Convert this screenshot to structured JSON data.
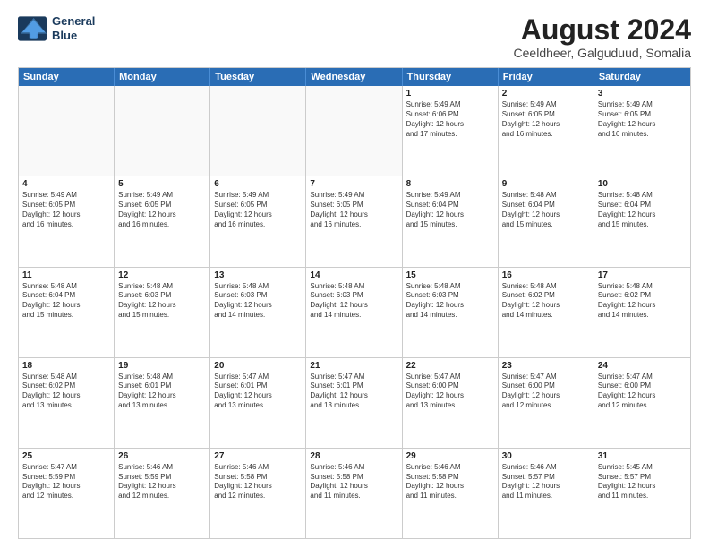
{
  "logo": {
    "line1": "General",
    "line2": "Blue"
  },
  "title": "August 2024",
  "subtitle": "Ceeldheer, Galguduud, Somalia",
  "header": {
    "days": [
      "Sunday",
      "Monday",
      "Tuesday",
      "Wednesday",
      "Thursday",
      "Friday",
      "Saturday"
    ]
  },
  "weeks": [
    [
      {
        "day": "",
        "info": ""
      },
      {
        "day": "",
        "info": ""
      },
      {
        "day": "",
        "info": ""
      },
      {
        "day": "",
        "info": ""
      },
      {
        "day": "1",
        "info": "Sunrise: 5:49 AM\nSunset: 6:06 PM\nDaylight: 12 hours\nand 17 minutes."
      },
      {
        "day": "2",
        "info": "Sunrise: 5:49 AM\nSunset: 6:05 PM\nDaylight: 12 hours\nand 16 minutes."
      },
      {
        "day": "3",
        "info": "Sunrise: 5:49 AM\nSunset: 6:05 PM\nDaylight: 12 hours\nand 16 minutes."
      }
    ],
    [
      {
        "day": "4",
        "info": "Sunrise: 5:49 AM\nSunset: 6:05 PM\nDaylight: 12 hours\nand 16 minutes."
      },
      {
        "day": "5",
        "info": "Sunrise: 5:49 AM\nSunset: 6:05 PM\nDaylight: 12 hours\nand 16 minutes."
      },
      {
        "day": "6",
        "info": "Sunrise: 5:49 AM\nSunset: 6:05 PM\nDaylight: 12 hours\nand 16 minutes."
      },
      {
        "day": "7",
        "info": "Sunrise: 5:49 AM\nSunset: 6:05 PM\nDaylight: 12 hours\nand 16 minutes."
      },
      {
        "day": "8",
        "info": "Sunrise: 5:49 AM\nSunset: 6:04 PM\nDaylight: 12 hours\nand 15 minutes."
      },
      {
        "day": "9",
        "info": "Sunrise: 5:48 AM\nSunset: 6:04 PM\nDaylight: 12 hours\nand 15 minutes."
      },
      {
        "day": "10",
        "info": "Sunrise: 5:48 AM\nSunset: 6:04 PM\nDaylight: 12 hours\nand 15 minutes."
      }
    ],
    [
      {
        "day": "11",
        "info": "Sunrise: 5:48 AM\nSunset: 6:04 PM\nDaylight: 12 hours\nand 15 minutes."
      },
      {
        "day": "12",
        "info": "Sunrise: 5:48 AM\nSunset: 6:03 PM\nDaylight: 12 hours\nand 15 minutes."
      },
      {
        "day": "13",
        "info": "Sunrise: 5:48 AM\nSunset: 6:03 PM\nDaylight: 12 hours\nand 14 minutes."
      },
      {
        "day": "14",
        "info": "Sunrise: 5:48 AM\nSunset: 6:03 PM\nDaylight: 12 hours\nand 14 minutes."
      },
      {
        "day": "15",
        "info": "Sunrise: 5:48 AM\nSunset: 6:03 PM\nDaylight: 12 hours\nand 14 minutes."
      },
      {
        "day": "16",
        "info": "Sunrise: 5:48 AM\nSunset: 6:02 PM\nDaylight: 12 hours\nand 14 minutes."
      },
      {
        "day": "17",
        "info": "Sunrise: 5:48 AM\nSunset: 6:02 PM\nDaylight: 12 hours\nand 14 minutes."
      }
    ],
    [
      {
        "day": "18",
        "info": "Sunrise: 5:48 AM\nSunset: 6:02 PM\nDaylight: 12 hours\nand 13 minutes."
      },
      {
        "day": "19",
        "info": "Sunrise: 5:48 AM\nSunset: 6:01 PM\nDaylight: 12 hours\nand 13 minutes."
      },
      {
        "day": "20",
        "info": "Sunrise: 5:47 AM\nSunset: 6:01 PM\nDaylight: 12 hours\nand 13 minutes."
      },
      {
        "day": "21",
        "info": "Sunrise: 5:47 AM\nSunset: 6:01 PM\nDaylight: 12 hours\nand 13 minutes."
      },
      {
        "day": "22",
        "info": "Sunrise: 5:47 AM\nSunset: 6:00 PM\nDaylight: 12 hours\nand 13 minutes."
      },
      {
        "day": "23",
        "info": "Sunrise: 5:47 AM\nSunset: 6:00 PM\nDaylight: 12 hours\nand 12 minutes."
      },
      {
        "day": "24",
        "info": "Sunrise: 5:47 AM\nSunset: 6:00 PM\nDaylight: 12 hours\nand 12 minutes."
      }
    ],
    [
      {
        "day": "25",
        "info": "Sunrise: 5:47 AM\nSunset: 5:59 PM\nDaylight: 12 hours\nand 12 minutes."
      },
      {
        "day": "26",
        "info": "Sunrise: 5:46 AM\nSunset: 5:59 PM\nDaylight: 12 hours\nand 12 minutes."
      },
      {
        "day": "27",
        "info": "Sunrise: 5:46 AM\nSunset: 5:58 PM\nDaylight: 12 hours\nand 12 minutes."
      },
      {
        "day": "28",
        "info": "Sunrise: 5:46 AM\nSunset: 5:58 PM\nDaylight: 12 hours\nand 11 minutes."
      },
      {
        "day": "29",
        "info": "Sunrise: 5:46 AM\nSunset: 5:58 PM\nDaylight: 12 hours\nand 11 minutes."
      },
      {
        "day": "30",
        "info": "Sunrise: 5:46 AM\nSunset: 5:57 PM\nDaylight: 12 hours\nand 11 minutes."
      },
      {
        "day": "31",
        "info": "Sunrise: 5:45 AM\nSunset: 5:57 PM\nDaylight: 12 hours\nand 11 minutes."
      }
    ]
  ]
}
